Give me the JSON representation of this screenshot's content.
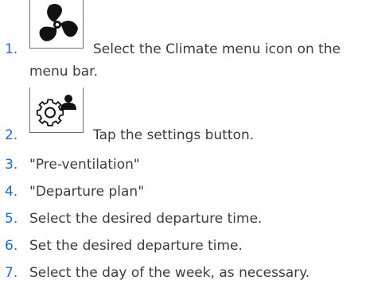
{
  "steps": [
    {
      "number": "1.",
      "text_line1": "Select the Climate menu icon on the",
      "text_line2": "menu bar.",
      "icon": "fan-icon"
    },
    {
      "number": "2.",
      "text": "Tap the settings button.",
      "icon": "settings-person-gear-icon"
    },
    {
      "number": "3.",
      "text": "\"Pre-ventilation\""
    },
    {
      "number": "4.",
      "text": "\"Departure plan\""
    },
    {
      "number": "5.",
      "text": "Select the desired departure time."
    },
    {
      "number": "6.",
      "text": "Set the desired departure time."
    },
    {
      "number": "7.",
      "text": "Select the day of the week, as necessary."
    }
  ],
  "colors": {
    "number": "#1c69d4",
    "text": "#3c3c3c",
    "icon_frame": "#6b6b6b",
    "icon": "#111111"
  }
}
